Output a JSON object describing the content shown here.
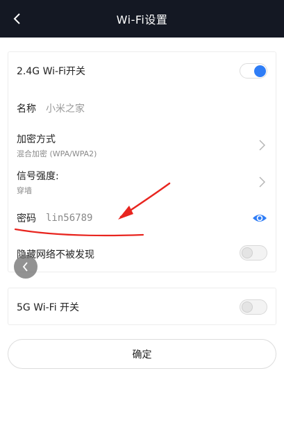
{
  "header": {
    "title": "Wi-Fi设置",
    "back_icon": "chevron-left-icon"
  },
  "wifi24": {
    "label": "2.4G Wi-Fi开关",
    "enabled": true
  },
  "name": {
    "label": "名称",
    "value": "小米之家"
  },
  "encryption": {
    "label": "加密方式",
    "value": "混合加密 (WPA/WPA2)"
  },
  "signal": {
    "label": "信号强度:",
    "value": "穿墙"
  },
  "password": {
    "label": "密码",
    "value": "lin56789",
    "visibility_icon": "eye-icon"
  },
  "hidden_network": {
    "label": "隐藏网络不被发现",
    "enabled": false
  },
  "wifi5g": {
    "label": "5G Wi-Fi 开关",
    "enabled": false
  },
  "confirm": {
    "label": "确定"
  },
  "colors": {
    "header_bg": "#141823",
    "accent": "#2f7df6",
    "annotation": "#e8251f"
  }
}
